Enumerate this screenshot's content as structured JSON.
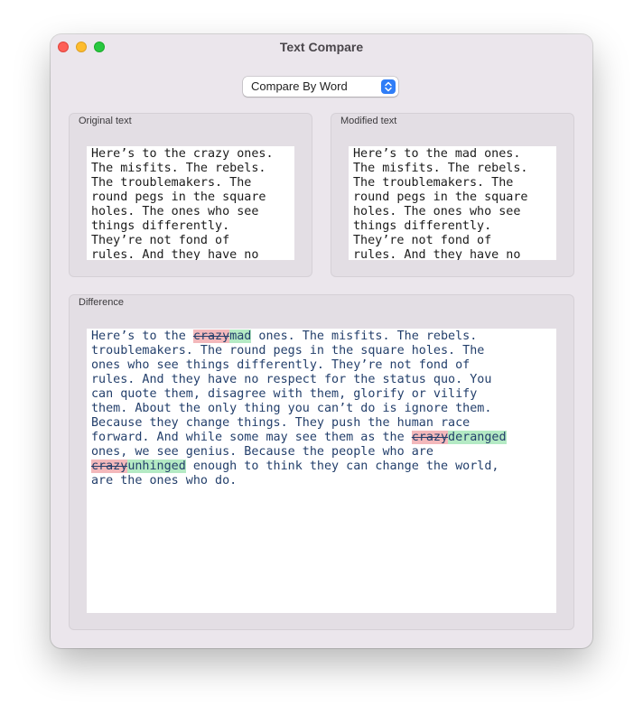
{
  "window": {
    "title": "Text Compare"
  },
  "compare_mode": {
    "selected": "Compare By Word"
  },
  "original": {
    "label": "Original text",
    "text": "Here’s to the crazy ones.\nThe misfits. The rebels.\nThe troublemakers. The\nround pegs in the square\nholes. The ones who see\nthings differently.\nThey’re not fond of\nrules. And they have no"
  },
  "modified": {
    "label": "Modified text",
    "text": "Here’s to the mad ones.\nThe misfits. The rebels.\nThe troublemakers. The\nround pegs in the square\nholes. The ones who see\nthings differently.\nThey’re not fond of\nrules. And they have no"
  },
  "difference": {
    "label": "Difference",
    "segments": [
      {
        "type": "same",
        "text": "Here’s to the "
      },
      {
        "type": "del",
        "text": "crazy"
      },
      {
        "type": "ins",
        "text": "mad"
      },
      {
        "type": "same",
        "text": " ones. The misfits. The rebels.\ntroublemakers. The round pegs in the square holes. The\nones who see things differently. They’re not fond of\nrules. And they have no respect for the status quo. You\ncan quote them, disagree with them, glorify or vilify\nthem. About the only thing you can’t do is ignore them.\nBecause they change things. They push the human race\nforward. And while some may see them as the "
      },
      {
        "type": "del",
        "text": "crazy"
      },
      {
        "type": "ins",
        "text": "deranged"
      },
      {
        "type": "same",
        "text": "\nones, we see genius. Because the people who are\n"
      },
      {
        "type": "del",
        "text": "crazy"
      },
      {
        "type": "ins",
        "text": "unhinged"
      },
      {
        "type": "same",
        "text": " enough to think they can change the world,\nare the ones who do."
      }
    ]
  },
  "colors": {
    "deleted_highlight": "#f3b8bb",
    "inserted_highlight": "#b4eac4",
    "diff_text": "#233f6b",
    "accent": "#2f7df7"
  }
}
